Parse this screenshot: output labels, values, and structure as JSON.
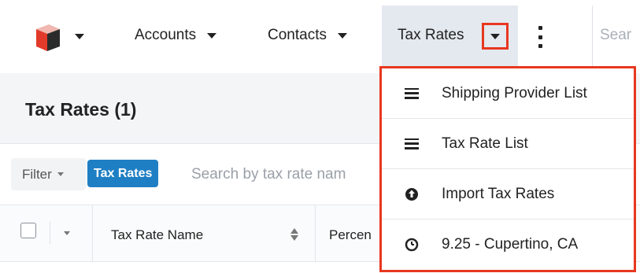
{
  "nav": {
    "logo_icon": "sugar-cube-logo-icon",
    "items": [
      {
        "label": "Accounts"
      },
      {
        "label": "Contacts"
      },
      {
        "label": "Tax Rates"
      }
    ],
    "search_placeholder": "Sear"
  },
  "page": {
    "title": "Tax Rates (1)"
  },
  "filter": {
    "button_label": "Filter",
    "tag_label": "Tax Rates",
    "search_placeholder": "Search by tax rate nam"
  },
  "table": {
    "columns": [
      "Tax Rate Name",
      "Percen"
    ]
  },
  "dropdown": {
    "items": [
      {
        "label": "Shipping Provider List",
        "icon": "list-icon"
      },
      {
        "label": "Tax Rate List",
        "icon": "list-icon"
      },
      {
        "label": "Import Tax Rates",
        "icon": "upload-circle-icon"
      },
      {
        "label": "9.25 - Cupertino, CA",
        "icon": "clock-icon"
      }
    ]
  },
  "colors": {
    "highlight": "#e8371f",
    "accent": "#1f7fc4",
    "active_tab": "#e4e9ef"
  }
}
